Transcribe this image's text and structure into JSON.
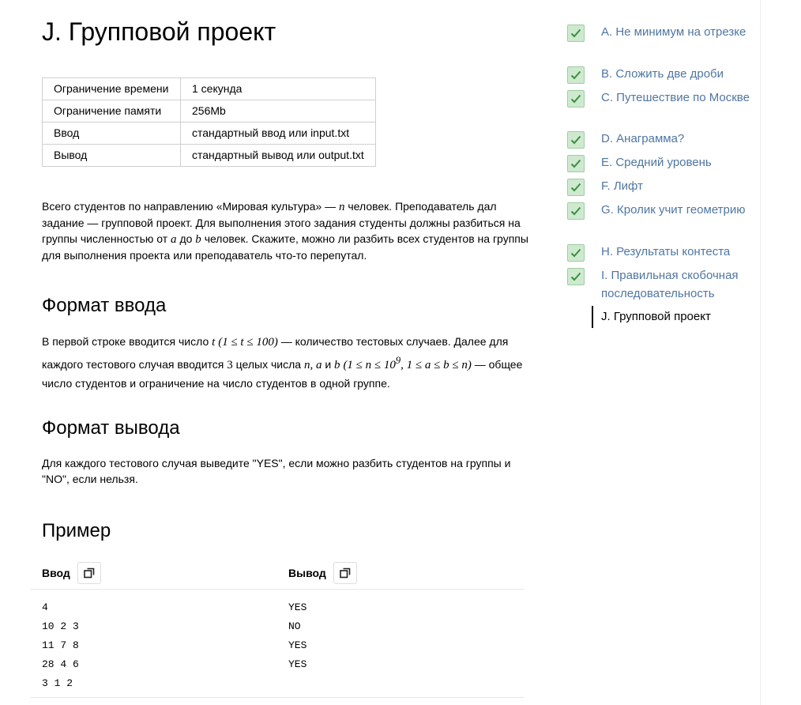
{
  "problem": {
    "title": "J. Групповой проект",
    "limits": [
      {
        "key": "Ограничение времени",
        "value": "1 секунда"
      },
      {
        "key": "Ограничение памяти",
        "value": "256Mb"
      },
      {
        "key": "Ввод",
        "value": "стандартный ввод или input.txt"
      },
      {
        "key": "Вывод",
        "value": "стандартный вывод или output.txt"
      }
    ],
    "legend": {
      "p1": "Всего студентов по направлению «Мировая культура» —",
      "var_n": "n",
      "p2": "человек. Преподаватель дал задание — групповой проект. Для выполнения этого задания студенты должны разбиться на группы численностью от",
      "var_a": "a",
      "p3": "до",
      "var_b": "b",
      "p4": "человек. Скажите, можно ли разбить всех студентов на группы для выполнения проекта или преподаватель что-то перепутал."
    },
    "input_heading": "Формат ввода",
    "input_format": {
      "p1": "В первой строке вводится число",
      "t": "t",
      "c1": "(1 ≤ t ≤ 100)",
      "p2": "— количество тестовых случаев. Далее для каждого тестового случая вводится",
      "three": "3",
      "p3": "целых числа",
      "vars": "n, a",
      "and": "и",
      "b": "b",
      "c2_open": "(1 ≤ n ≤ 10",
      "c2_sup": "9",
      "c2_close": ", 1 ≤ a ≤ b ≤ n)",
      "p4": "— общее число студентов и ограничение на число студентов в одной группе."
    },
    "output_heading": "Формат вывода",
    "output_format": "Для каждого тестового случая выведите \"YES\", если можно разбить студентов на группы и \"NO\", если нельзя.",
    "example_heading": "Пример",
    "example": {
      "input_label": "Ввод",
      "output_label": "Вывод",
      "input_lines": [
        "4",
        "10 2 3",
        "11 7 8",
        "28 4 6",
        "3 1 2"
      ],
      "output_lines": [
        "YES",
        "NO",
        "YES",
        "YES"
      ]
    }
  },
  "nav": {
    "items": [
      {
        "label": "A. Не минимум на отрезке",
        "solved": true
      },
      {
        "label": "B. Сложить две дроби",
        "solved": true
      },
      {
        "label": "C. Путешествие по Москве",
        "solved": true
      },
      {
        "label": "D. Анаграмма?",
        "solved": true
      },
      {
        "label": "E. Средний уровень",
        "solved": true
      },
      {
        "label": "F. Лифт",
        "solved": true
      },
      {
        "label": "G. Кролик учит геометрию",
        "solved": true
      },
      {
        "label": "H. Результаты контеста",
        "solved": true
      },
      {
        "label": "I. Правильная скобочная последовательность",
        "solved": true
      },
      {
        "label": "J. Групповой проект",
        "solved": false,
        "current": true
      }
    ]
  },
  "colors": {
    "link": "#4f76a3",
    "check_bg": "#cfe9d0",
    "check_mark": "#3a8f3e"
  }
}
